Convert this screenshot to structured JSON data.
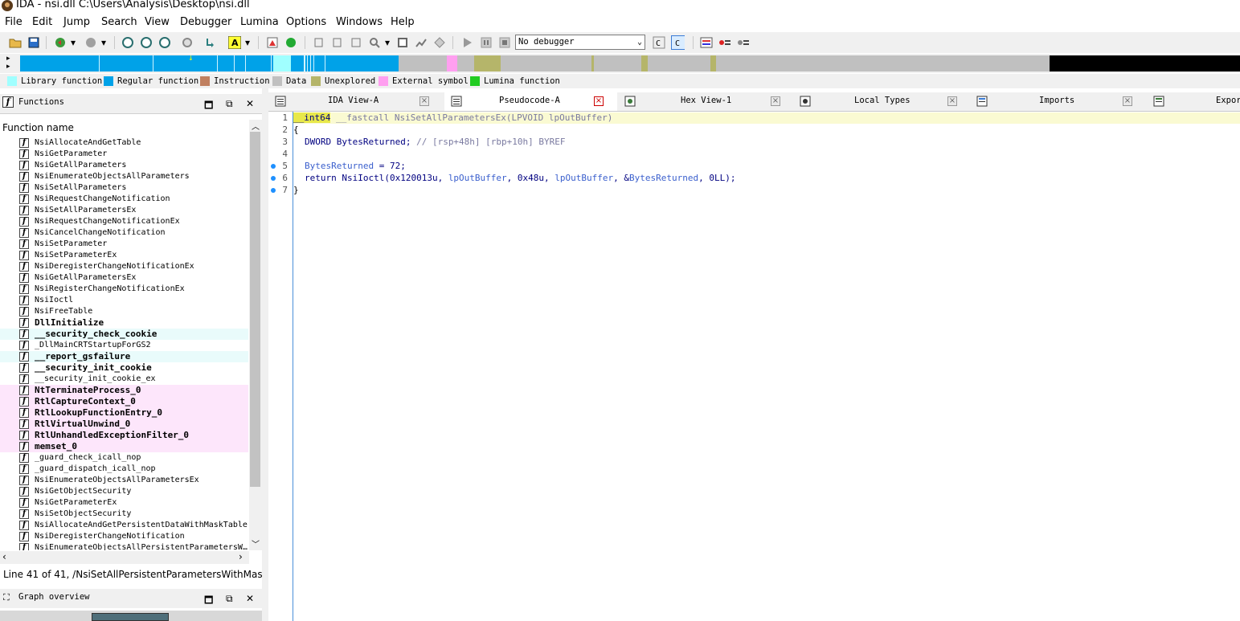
{
  "window": {
    "title": "IDA - nsi.dll C:\\Users\\Analysis\\Desktop\\nsi.dll"
  },
  "menu": [
    "File",
    "Edit",
    "Jump",
    "Search",
    "View",
    "Debugger",
    "Lumina",
    "Options",
    "Windows",
    "Help"
  ],
  "toolbar": {
    "debugger_select": "No debugger"
  },
  "legend": [
    {
      "label": "Library function",
      "color": "#a0ffff"
    },
    {
      "label": "Regular function",
      "color": "#00a2e8"
    },
    {
      "label": "Instruction",
      "color": "#c08060"
    },
    {
      "label": "Data",
      "color": "#c0c0c0"
    },
    {
      "label": "Unexplored",
      "color": "#b5b56a"
    },
    {
      "label": "External symbol",
      "color": "#ff9ff0"
    },
    {
      "label": "Lumina function",
      "color": "#22cc22"
    }
  ],
  "functions_pane": {
    "title": "Functions",
    "column": "Function name",
    "items": [
      {
        "name": "NsiAllocateAndGetTable",
        "style": "normal"
      },
      {
        "name": "NsiGetParameter",
        "style": "normal"
      },
      {
        "name": "NsiGetAllParameters",
        "style": "normal"
      },
      {
        "name": "NsiEnumerateObjectsAllParameters",
        "style": "normal"
      },
      {
        "name": "NsiSetAllParameters",
        "style": "normal"
      },
      {
        "name": "NsiRequestChangeNotification",
        "style": "normal"
      },
      {
        "name": "NsiSetAllParametersEx",
        "style": "normal"
      },
      {
        "name": "NsiRequestChangeNotificationEx",
        "style": "normal"
      },
      {
        "name": "NsiCancelChangeNotification",
        "style": "normal"
      },
      {
        "name": "NsiSetParameter",
        "style": "normal"
      },
      {
        "name": "NsiSetParameterEx",
        "style": "normal"
      },
      {
        "name": "NsiDeregisterChangeNotificationEx",
        "style": "normal"
      },
      {
        "name": "NsiGetAllParametersEx",
        "style": "normal"
      },
      {
        "name": "NsiRegisterChangeNotificationEx",
        "style": "normal"
      },
      {
        "name": "NsiIoctl",
        "style": "normal"
      },
      {
        "name": "NsiFreeTable",
        "style": "normal"
      },
      {
        "name": "DllInitialize",
        "style": "bold"
      },
      {
        "name": "__security_check_cookie",
        "style": "lib"
      },
      {
        "name": "_DllMainCRTStartupForGS2",
        "style": "normal"
      },
      {
        "name": "__report_gsfailure",
        "style": "lib"
      },
      {
        "name": "__security_init_cookie",
        "style": "bold"
      },
      {
        "name": "__security_init_cookie_ex",
        "style": "normal"
      },
      {
        "name": "NtTerminateProcess_0",
        "style": "ext"
      },
      {
        "name": "RtlCaptureContext_0",
        "style": "ext"
      },
      {
        "name": "RtlLookupFunctionEntry_0",
        "style": "ext"
      },
      {
        "name": "RtlVirtualUnwind_0",
        "style": "ext"
      },
      {
        "name": "RtlUnhandledExceptionFilter_0",
        "style": "ext"
      },
      {
        "name": "memset_0",
        "style": "ext"
      },
      {
        "name": "_guard_check_icall_nop",
        "style": "normal"
      },
      {
        "name": "_guard_dispatch_icall_nop",
        "style": "normal"
      },
      {
        "name": "NsiEnumerateObjectsAllParametersEx",
        "style": "normal"
      },
      {
        "name": "NsiGetObjectSecurity",
        "style": "normal"
      },
      {
        "name": "NsiGetParameterEx",
        "style": "normal"
      },
      {
        "name": "NsiSetObjectSecurity",
        "style": "normal"
      },
      {
        "name": "NsiAllocateAndGetPersistentDataWithMaskTable",
        "style": "normal"
      },
      {
        "name": "NsiDeregisterChangeNotification",
        "style": "normal"
      },
      {
        "name": "NsiEnumerateObjectsAllPersistentParametersW…",
        "style": "normal"
      }
    ],
    "status": "Line 41 of 41, /NsiSetAllPersistentParametersWithMas"
  },
  "graph_pane": {
    "title": "Graph overview"
  },
  "tabs": [
    {
      "label": "IDA View-A",
      "active": false
    },
    {
      "label": "Pseudocode-A",
      "active": true
    },
    {
      "label": "Hex View-1",
      "active": false
    },
    {
      "label": "Local Types",
      "active": false
    },
    {
      "label": "Imports",
      "active": false
    },
    {
      "label": "Expor",
      "active": false
    }
  ],
  "code": {
    "line_numbers": [
      "1",
      "2",
      "3",
      "4",
      "5",
      "6",
      "7"
    ],
    "l1_type": "__int64",
    "l1_rest": " __fastcall NsiSetAllParametersEx(LPVOID lpOutBuffer)",
    "l2": "{",
    "l3_decl": "DWORD BytesReturned; ",
    "l3_comment": "// [rsp+48h] [rbp+10h] BYREF",
    "l5_var": "BytesReturned",
    "l5_rest": " = 72;",
    "l6_a": "return NsiIoctl(0x120013u, ",
    "l6_b": "lpOutBuffer",
    "l6_c": ", 0x48u, ",
    "l6_d": "lpOutBuffer",
    "l6_e": ", &",
    "l6_f": "BytesReturned",
    "l6_g": ", 0LL);",
    "l7": "}"
  }
}
